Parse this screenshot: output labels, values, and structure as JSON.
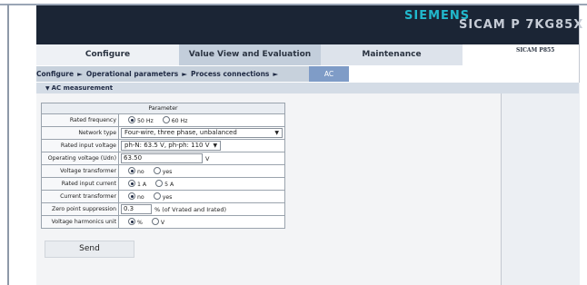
{
  "header": {
    "brand": "SIEMENS",
    "product": "SICAM P 7KG85X"
  },
  "tabs": [
    {
      "label": "Configure",
      "active": true
    },
    {
      "label": "Value View and Evaluation",
      "active": false
    },
    {
      "label": "Maintenance",
      "active": false
    }
  ],
  "device_tag": "SICAM P855",
  "breadcrumb": [
    "Configure",
    "Operational parameters",
    "Process connections",
    "AC"
  ],
  "breadcrumb_separator": "►",
  "section": {
    "title": "AC measurement",
    "expanded": true
  },
  "table": {
    "header": "Parameter",
    "rows": {
      "rated_frequency": {
        "label": "Rated frequency",
        "options": [
          "50 Hz",
          "60 Hz"
        ],
        "selected": "50 Hz"
      },
      "network_type": {
        "label": "Network type",
        "value": "Four-wire, three phase, unbalanced"
      },
      "rated_input_voltage": {
        "label": "Rated input voltage",
        "value": "ph-N: 63.5 V, ph-ph: 110 V"
      },
      "operating_voltage": {
        "label": "Operating voltage (Udn)",
        "value": "63.50",
        "unit": "V"
      },
      "voltage_transformer": {
        "label": "Voltage transformer",
        "options": [
          "no",
          "yes"
        ],
        "selected": "no"
      },
      "rated_input_current": {
        "label": "Rated input current",
        "options": [
          "1 A",
          "5 A"
        ],
        "selected": "1 A"
      },
      "current_transformer": {
        "label": "Current transformer",
        "options": [
          "no",
          "yes"
        ],
        "selected": "no"
      },
      "zero_point_suppression": {
        "label": "Zero point suppression",
        "value": "0.3",
        "unit": "% (of Vrated and Irated)"
      },
      "voltage_harmonics_unit": {
        "label": "Voltage harmonics unit",
        "options": [
          "%",
          "V"
        ],
        "selected": "%"
      }
    }
  },
  "send_label": "Send",
  "colors": {
    "header_bg": "#1b2535",
    "brand": "#21b8cc",
    "crumb_active": "#7f9cc7",
    "crumb_bar": "#c7d1dc"
  }
}
